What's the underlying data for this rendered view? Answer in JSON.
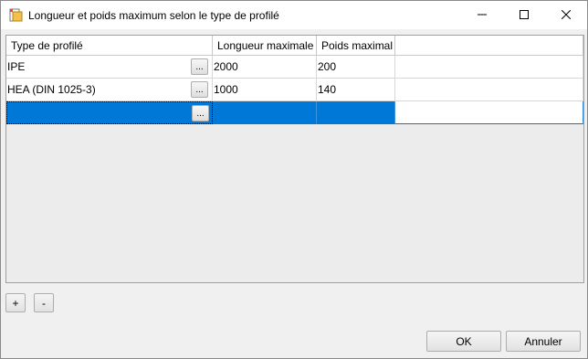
{
  "window": {
    "title": "Longueur et poids maximum selon le type de profilé"
  },
  "table": {
    "headers": [
      "Type de profilé",
      "Longueur maximale",
      "Poids maximal"
    ],
    "rows": [
      {
        "type": "IPE",
        "length": "2000",
        "weight": "200",
        "button": "..."
      },
      {
        "type": "HEA (DIN 1025-3)",
        "length": "1000",
        "weight": "140",
        "button": "..."
      },
      {
        "type": "",
        "length": "",
        "weight": "",
        "button": "...",
        "selected": true
      }
    ]
  },
  "buttons": {
    "add": "+",
    "remove": "-",
    "ok": "OK",
    "cancel": "Annuler"
  },
  "colors": {
    "selection": "#0078d7",
    "window_bg": "#f0f0f0"
  }
}
